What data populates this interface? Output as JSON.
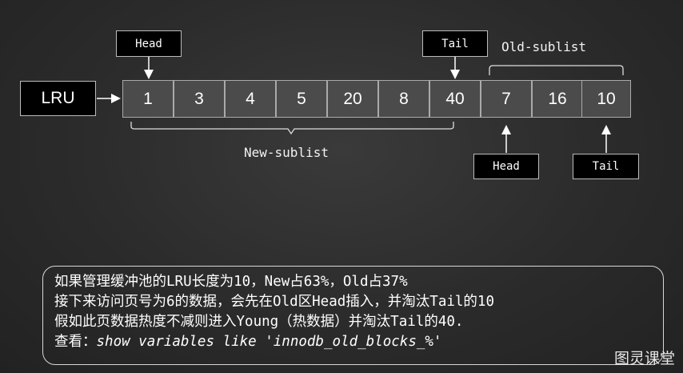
{
  "lru_label": "LRU",
  "cells": [
    "1",
    "3",
    "4",
    "5",
    "20",
    "8",
    "40",
    "7",
    "16",
    "10"
  ],
  "tags": {
    "new_head": "Head",
    "new_tail": "Tail",
    "old_head": "Head",
    "old_tail": "Tail"
  },
  "labels": {
    "old_sublist": "Old-sublist",
    "new_sublist": "New-sublist"
  },
  "note": {
    "line1": "如果管理缓冲池的LRU长度为10，New占63%，Old占37%",
    "line2": "接下来访问页号为6的数据，会先在Old区Head插入，并淘汰Tail的10",
    "line3": "假如此页数据热度不减则进入Young（热数据）并淘汰Tail的40.",
    "line4_prefix": "查看：",
    "line4_code": "show variables like 'innodb_old_blocks_%'"
  },
  "watermark": "图灵课堂"
}
